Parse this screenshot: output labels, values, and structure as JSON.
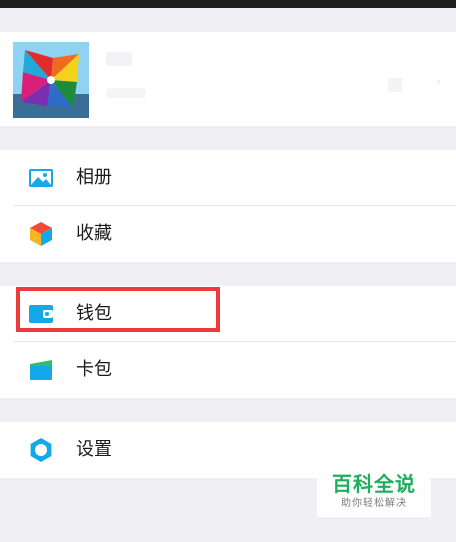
{
  "profile": {
    "avatar": "pinwheel-avatar"
  },
  "menu": {
    "items": [
      {
        "label": "相册",
        "icon": "photo-album-icon"
      },
      {
        "label": "收藏",
        "icon": "favorites-cube-icon"
      },
      {
        "label": "钱包",
        "icon": "wallet-icon"
      },
      {
        "label": "卡包",
        "icon": "card-pack-icon"
      },
      {
        "label": "设置",
        "icon": "settings-gear-icon"
      }
    ]
  },
  "highlight": {
    "target": "钱包",
    "color": "#ee3a3a"
  },
  "watermark": {
    "title": "百科全说",
    "subtitle": "助你轻松解决"
  },
  "colors": {
    "accent_blue": "#12a8ea",
    "watermark_green": "#1fae5c",
    "page_background": "#efeff4"
  }
}
